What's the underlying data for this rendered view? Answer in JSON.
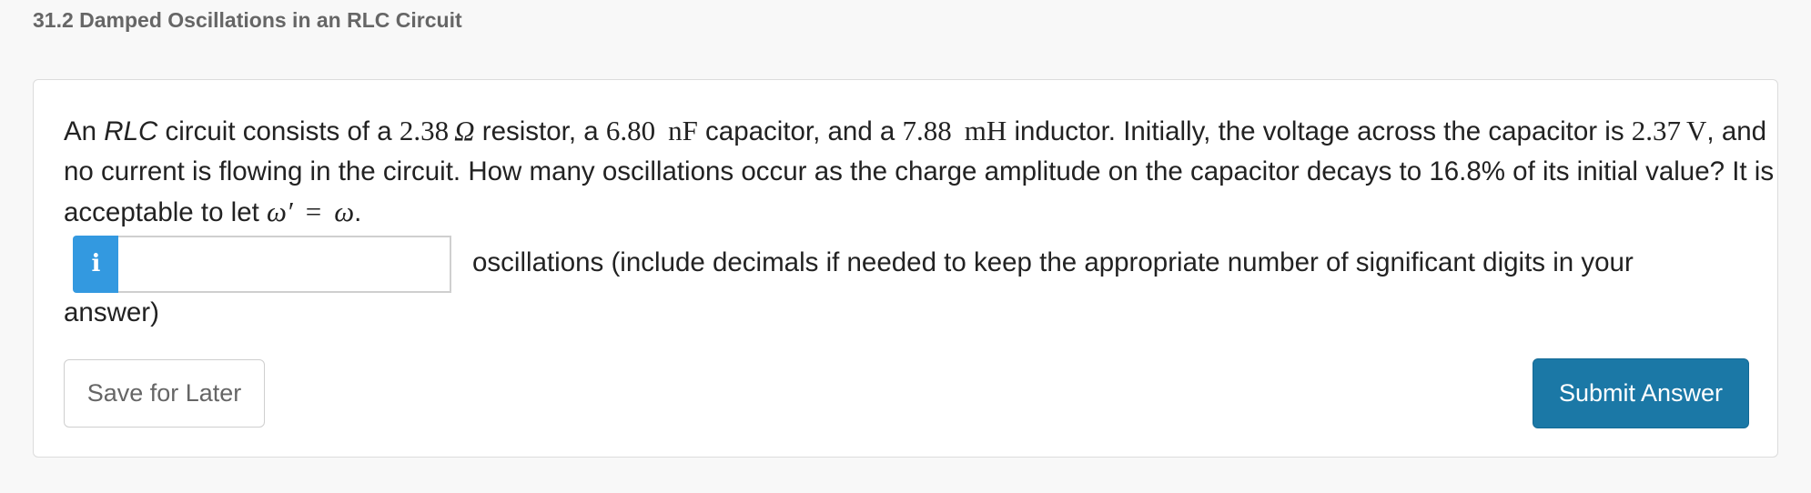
{
  "section": {
    "title": "31.2 Damped Oscillations in an RLC Circuit"
  },
  "question": {
    "t1": "An ",
    "rlc": "RLC",
    "t2": " circuit consists of a ",
    "resistance": "2.38",
    "ohm": "Ω",
    "t3": " resistor, a ",
    "capacitance": "6.80",
    "cap_unit": "nF",
    "t4": " capacitor, and a ",
    "inductance": "7.88",
    "ind_unit": "mH",
    "t5": " inductor. Initially, the voltage across the capacitor is ",
    "voltage": "2.37",
    "volt_unit": "V",
    "t6": ", and no current is flowing in the circuit. How many oscillations occur as the charge amplitude on the capacitor decays to 16.8% of its initial value? It is acceptable to let ",
    "omega_prime": "ω′",
    "equals": "=",
    "omega": "ω",
    "t7": "."
  },
  "answer": {
    "info_icon": "info-icon",
    "info_glyph": "i",
    "value": "",
    "placeholder": "",
    "unit_line1": "oscillations (include decimals if needed to keep the appropriate number of significant digits in your",
    "unit_line2": "answer)"
  },
  "actions": {
    "save_label": "Save for Later",
    "submit_label": "Submit Answer"
  },
  "colors": {
    "info_blue": "#3399e0",
    "submit_blue": "#1b78a6"
  }
}
